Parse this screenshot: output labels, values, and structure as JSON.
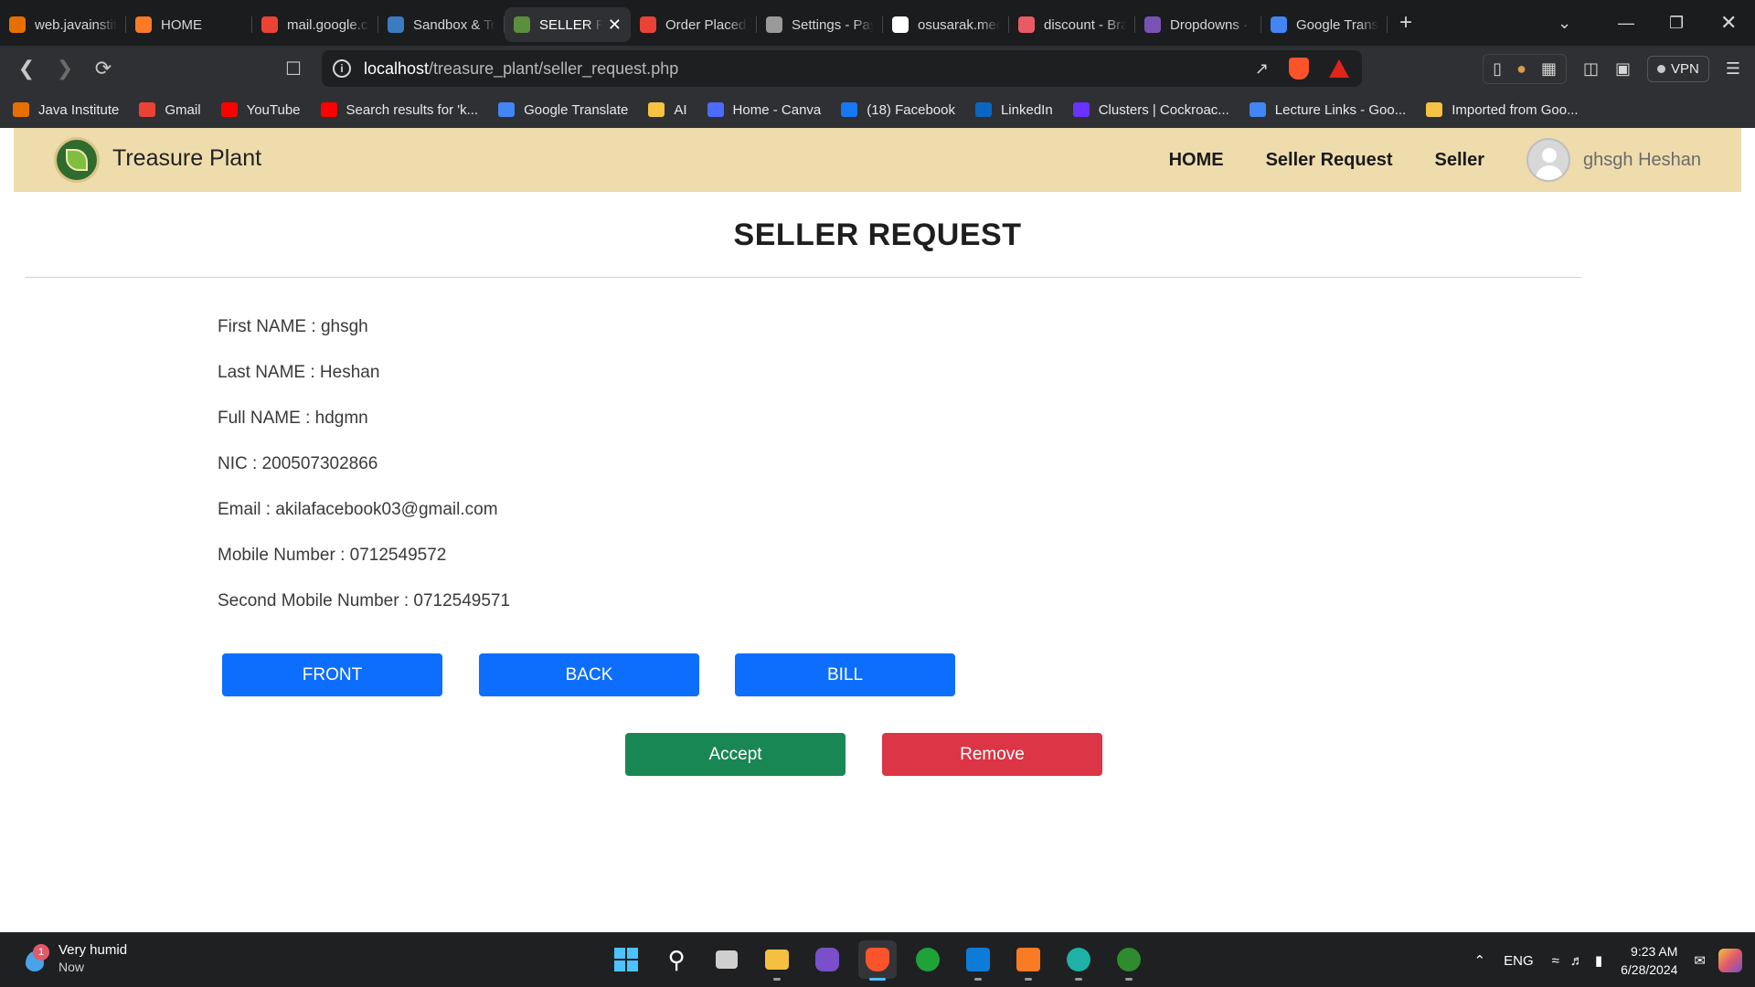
{
  "browser": {
    "tabs": [
      {
        "label": "web.javainstit",
        "icon": "java-icon",
        "color": "#e76f00"
      },
      {
        "label": "HOME",
        "icon": "xampp-icon",
        "color": "#fb7a24"
      },
      {
        "label": "mail.google.c",
        "icon": "gmail-icon",
        "color": "#ea4335"
      },
      {
        "label": "Sandbox & To",
        "icon": "paypal-icon",
        "color": "#3b7bbf"
      },
      {
        "label": "SELLER R",
        "icon": "treasure-plant-icon",
        "color": "#5a8f3b",
        "active": true
      },
      {
        "label": "Order Placed",
        "icon": "gmail-icon",
        "color": "#ea4335"
      },
      {
        "label": "Settings - Pay",
        "icon": "gear-icon",
        "color": "#9a9a9a"
      },
      {
        "label": "osusarak.med",
        "icon": "medium-icon",
        "color": "#ffffff"
      },
      {
        "label": "discount - Bra",
        "icon": "brave-talk-icon",
        "color": "#e85b64"
      },
      {
        "label": "Dropdowns ·",
        "icon": "bootstrap-icon",
        "color": "#7952b3"
      },
      {
        "label": "Google Transl",
        "icon": "google-translate-icon",
        "color": "#4285f4"
      }
    ],
    "new_tab": "+",
    "url_host": "localhost",
    "url_path": "/treasure_plant/seller_request.php",
    "vpn_label": "VPN",
    "bookmarks": [
      {
        "label": "Java Institute",
        "color": "#e76f00"
      },
      {
        "label": "Gmail",
        "color": "#ea4335"
      },
      {
        "label": "YouTube",
        "color": "#ff0000"
      },
      {
        "label": "Search results for 'k...",
        "color": "#ff0000"
      },
      {
        "label": "Google Translate",
        "color": "#4285f4"
      },
      {
        "label": "AI",
        "color": "#f5c242"
      },
      {
        "label": "Home - Canva",
        "color": "#4d6bfe"
      },
      {
        "label": "(18) Facebook",
        "color": "#1877f2"
      },
      {
        "label": "LinkedIn",
        "color": "#0a66c2"
      },
      {
        "label": "Clusters | Cockroac...",
        "color": "#6933ff"
      },
      {
        "label": "Lecture Links - Goo...",
        "color": "#4285f4"
      },
      {
        "label": "Imported from Goo...",
        "color": "#f5c242"
      }
    ]
  },
  "site": {
    "brand": "Treasure Plant",
    "nav": {
      "home": "HOME",
      "seller_request": "Seller Request",
      "seller": "Seller",
      "username": "ghsgh Heshan"
    },
    "title": "SELLER REQUEST",
    "details": [
      "First NAME : ghsgh",
      "Last NAME : Heshan",
      "Full NAME : hdgmn",
      "NIC : 200507302866",
      "Email : akilafacebook03@gmail.com",
      "Mobile Number : 0712549572",
      "Second Mobile Number : 0712549571"
    ],
    "buttons": {
      "front": "FRONT",
      "back": "BACK",
      "bill": "BILL",
      "accept": "Accept",
      "remove": "Remove"
    },
    "colors": {
      "nav_bg": "#efdcad",
      "primary": "#0d6efd",
      "success": "#198754",
      "danger": "#dc3545"
    }
  },
  "taskbar": {
    "weather_title": "Very humid",
    "weather_sub": "Now",
    "weather_badge": "1",
    "language": "ENG",
    "time": "9:23 AM",
    "date": "6/28/2024"
  }
}
